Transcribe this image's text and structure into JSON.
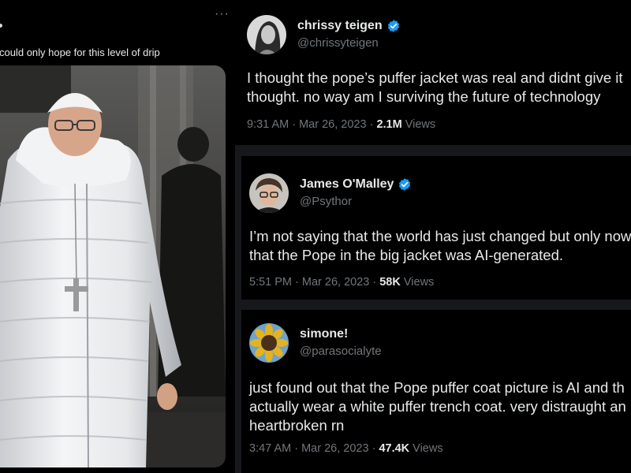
{
  "left_tweet": {
    "text": "could only hope for this level of drip",
    "more_icon": "more-horizontal-icon",
    "image_subject": "pope-in-white-puffer-jacket"
  },
  "tweets": [
    {
      "display_name": "chrissy teigen",
      "handle": "@chrissyteigen",
      "verified": true,
      "avatar_icon": "avatar-chrissy",
      "text_lines": [
        "I thought the pope’s puffer jacket was real and didnt give it",
        "thought. no way am I surviving the future of technology"
      ],
      "time": "9:31 AM",
      "date": "Mar 26, 2023",
      "views_count": "2.1M",
      "views_label": "Views"
    },
    {
      "display_name": "James O'Malley",
      "handle": "@Psythor",
      "verified": true,
      "avatar_icon": "avatar-james",
      "text_lines": [
        "I’m not saying that the world has just changed but only now",
        "that the Pope in the big jacket was AI-generated."
      ],
      "time": "5:51 PM",
      "date": "Mar 26, 2023",
      "views_count": "58K",
      "views_label": "Views"
    },
    {
      "display_name": "simone!",
      "handle": "@parasocialyte",
      "verified": false,
      "avatar_icon": "avatar-sunflower",
      "text_lines": [
        "just found out that the Pope puffer coat picture is AI and th",
        "actually wear a white puffer trench coat. very distraught an",
        "heartbroken rn"
      ],
      "time": "3:47 AM",
      "date": "Mar 26, 2023",
      "views_count": "47.4K",
      "views_label": "Views"
    }
  ],
  "colors": {
    "background": "#000000",
    "text": "#e7e9ea",
    "secondary_text": "#71767b",
    "verified_blue": "#1d9bf0",
    "gap": "#16181c"
  }
}
